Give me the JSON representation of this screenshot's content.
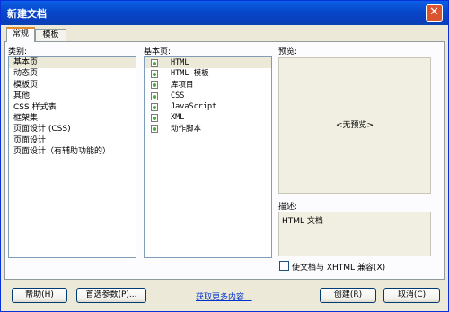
{
  "window": {
    "title": "新建文档",
    "close_glyph": "✕"
  },
  "tabs": [
    {
      "label": "常规"
    },
    {
      "label": "模板"
    }
  ],
  "category": {
    "label": "类别:",
    "items": [
      "基本页",
      "动态页",
      "模板页",
      "其他",
      "CSS 样式表",
      "框架集",
      "页面设计 (CSS)",
      "页面设计",
      "页面设计（有辅助功能的）"
    ],
    "selected_index": 0
  },
  "basic_page": {
    "label": "基本页:",
    "items": [
      "HTML",
      "HTML 模板",
      "库项目",
      "CSS",
      "JavaScript",
      "XML",
      "动作脚本"
    ],
    "selected_index": 0,
    "icon": "document-icon"
  },
  "preview": {
    "label": "预览:",
    "empty_text": "<无预览>"
  },
  "description": {
    "label": "描述:",
    "text": "HTML 文档"
  },
  "xhtml_checkbox": {
    "label": "使文档与 XHTML 兼容(X)",
    "checked": false
  },
  "buttons": {
    "help": "帮助(H)",
    "prefs": "首选参数(P)...",
    "get_more": "获取更多内容...",
    "create": "创建(R)",
    "cancel": "取消(C)"
  },
  "colors": {
    "title_bar": "#0a5fe6",
    "dialog_bg": "#ece9d8",
    "link": "#0033cc",
    "list_border": "#7f9db9"
  }
}
